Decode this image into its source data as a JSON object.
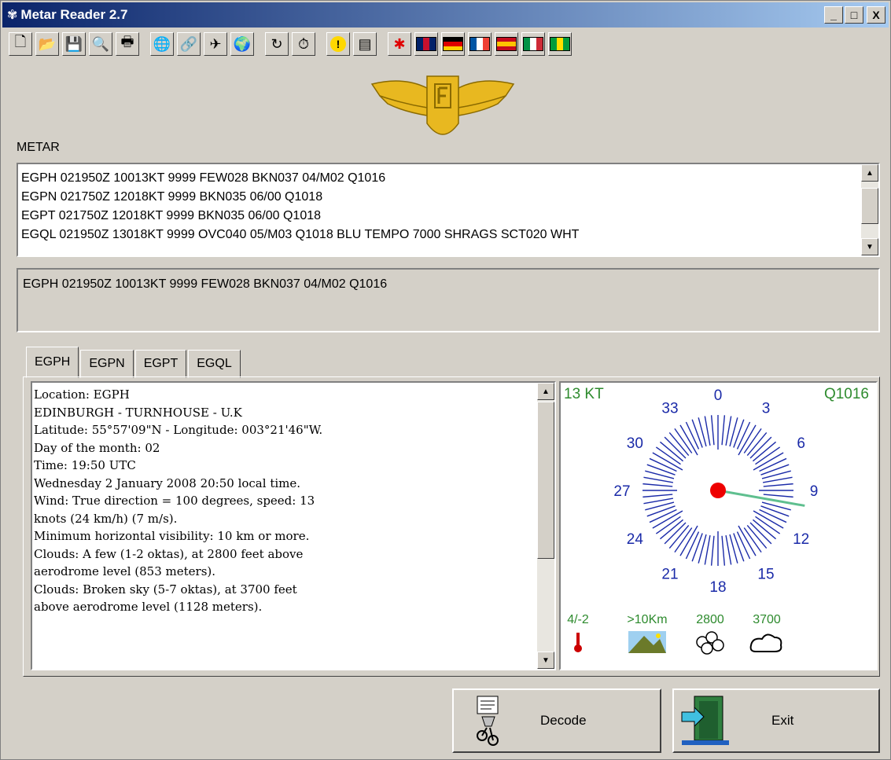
{
  "window": {
    "title": "Metar Reader 2.7",
    "controls": {
      "minimize": "_",
      "maximize": "□",
      "close": "X"
    }
  },
  "toolbar": {
    "buttons": [
      {
        "icon": "new-document-icon",
        "glyph": "🗋"
      },
      {
        "icon": "open-folder-icon",
        "glyph": "📂"
      },
      {
        "icon": "save-icon",
        "glyph": "💾"
      },
      {
        "icon": "print-preview-icon",
        "glyph": "🔍"
      },
      {
        "icon": "print-icon",
        "glyph": "🖶"
      },
      {
        "icon": "globe-icon",
        "glyph": "🌐"
      },
      {
        "icon": "search-airport-icon",
        "glyph": "🔗"
      },
      {
        "icon": "airplane-icon",
        "glyph": "✈"
      },
      {
        "icon": "internet-icon",
        "glyph": "🌍"
      },
      {
        "icon": "refresh-icon",
        "glyph": "↻"
      },
      {
        "icon": "timer-icon",
        "glyph": "⏱"
      },
      {
        "icon": "warning-icon",
        "glyph": "!"
      },
      {
        "icon": "database-icon",
        "glyph": "▤"
      },
      {
        "icon": "star-icon",
        "glyph": "✱"
      }
    ],
    "flags": [
      {
        "icon": "uk-flag-icon",
        "colors": [
          "#012169",
          "#c8102e",
          "#012169"
        ]
      },
      {
        "icon": "german-flag-icon",
        "colors": [
          "#000000",
          "#dd0000",
          "#ffce00"
        ],
        "horizontal": true
      },
      {
        "icon": "french-flag-icon",
        "colors": [
          "#0055a4",
          "#ffffff",
          "#ef4135"
        ]
      },
      {
        "icon": "spanish-flag-icon",
        "colors": [
          "#c60b1e",
          "#ffc400",
          "#c60b1e"
        ],
        "horizontal": true
      },
      {
        "icon": "italian-flag-icon",
        "colors": [
          "#009246",
          "#ffffff",
          "#ce2b37"
        ]
      },
      {
        "icon": "brazil-flag-icon",
        "colors": [
          "#009c3b",
          "#ffdf00",
          "#009c3b"
        ]
      }
    ]
  },
  "metar": {
    "label": "METAR",
    "lines": [
      "EGPH 021950Z 10013KT 9999 FEW028 BKN037 04/M02 Q1016",
      "EGPN 021750Z 12018KT 9999 BKN035 06/00 Q1018",
      "EGPT 021750Z 12018KT 9999 BKN035 06/00 Q1018",
      "EGQL 021950Z 13018KT 9999 OVC040 05/M03 Q1018 BLU TEMPO 7000 SHRAGS SCT020 WHT"
    ],
    "selected": "EGPH 021950Z 10013KT 9999 FEW028 BKN037 04/M02 Q1016"
  },
  "tabs": [
    "EGPH",
    "EGPN",
    "EGPT",
    "EGQL"
  ],
  "decoded": [
    "Location: EGPH",
    "EDINBURGH - TURNHOUSE - U.K",
    "Latitude: 55°57'09\"N - Longitude: 003°21'46\"W.",
    "Day of the month: 02",
    "Time: 19:50 UTC",
    "Wednesday 2 January 2008 20:50 local time.",
    "Wind: True direction = 100 degrees, speed: 13",
    "knots (24 km/h) (7 m/s).",
    "Minimum horizontal visibility: 10 km or more.",
    "Clouds: A few (1-2 oktas), at 2800 feet above",
    "aerodrome level (853 meters).",
    "Clouds: Broken sky (5-7 oktas), at 3700 feet",
    "above aerodrome level (1128 meters)."
  ],
  "wind": {
    "speed": "13 KT",
    "pressure": "Q1016",
    "direction_deg": 100,
    "dial_labels": [
      "0",
      "3",
      "6",
      "9",
      "12",
      "15",
      "18",
      "21",
      "24",
      "27",
      "30",
      "33"
    ]
  },
  "conditions": {
    "temperature": "4/-2",
    "visibility": ">10Km",
    "cloud1": "2800",
    "cloud2": "3700"
  },
  "buttons": {
    "decode": "Decode",
    "exit": "Exit"
  },
  "colors": {
    "dial": "#1a2aa8",
    "green_text": "#2e8b2e",
    "needle": "#5fbf8f",
    "hub": "#ee0000"
  }
}
